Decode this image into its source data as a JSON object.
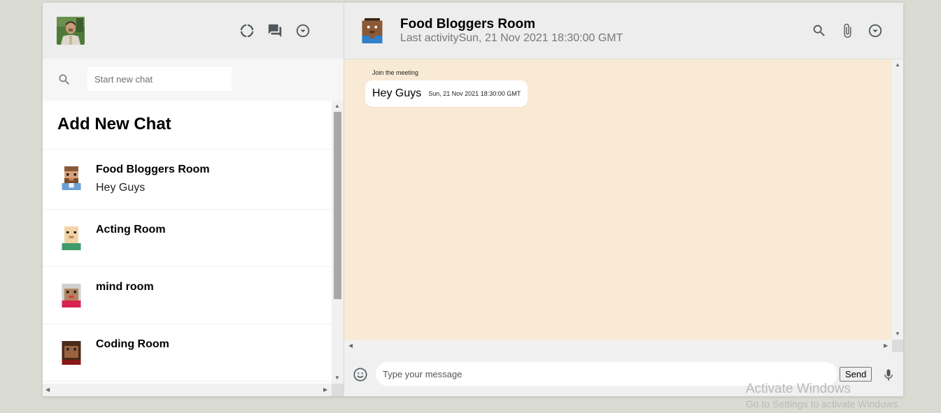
{
  "sidebar": {
    "header": {
      "user_avatar": "user-photo",
      "icons": [
        "status-icon",
        "chat-icon",
        "menu-dropdown-icon"
      ]
    },
    "search": {
      "placeholder": "Start new chat",
      "value": ""
    },
    "add_new_chat_label": "Add New Chat",
    "chats": [
      {
        "name": "Food Bloggers Room",
        "last_message": "Hey Guys"
      },
      {
        "name": "Acting Room",
        "last_message": ""
      },
      {
        "name": "mind room",
        "last_message": ""
      },
      {
        "name": "Coding Room",
        "last_message": ""
      }
    ]
  },
  "chat": {
    "header": {
      "room_name": "Food Bloggers Room",
      "last_activity": "Last activitySun, 21 Nov 2021 18:30:00 GMT",
      "icons": [
        "search-icon",
        "attach-icon",
        "menu-dropdown-icon"
      ]
    },
    "messages": [
      {
        "sender": "Join the meeting",
        "text": "Hey Guys",
        "timestamp": "Sun, 21 Nov 2021 18:30:00 GMT"
      }
    ],
    "footer": {
      "placeholder": "Type your message",
      "value": "",
      "send_label": "Send"
    }
  },
  "watermark": {
    "title": "Activate Windows",
    "subtitle": "Go to Settings to activate Windows."
  },
  "colors": {
    "chat_background": "#f9ead6",
    "header_background": "#ededed",
    "app_background": "#dadbd3"
  }
}
